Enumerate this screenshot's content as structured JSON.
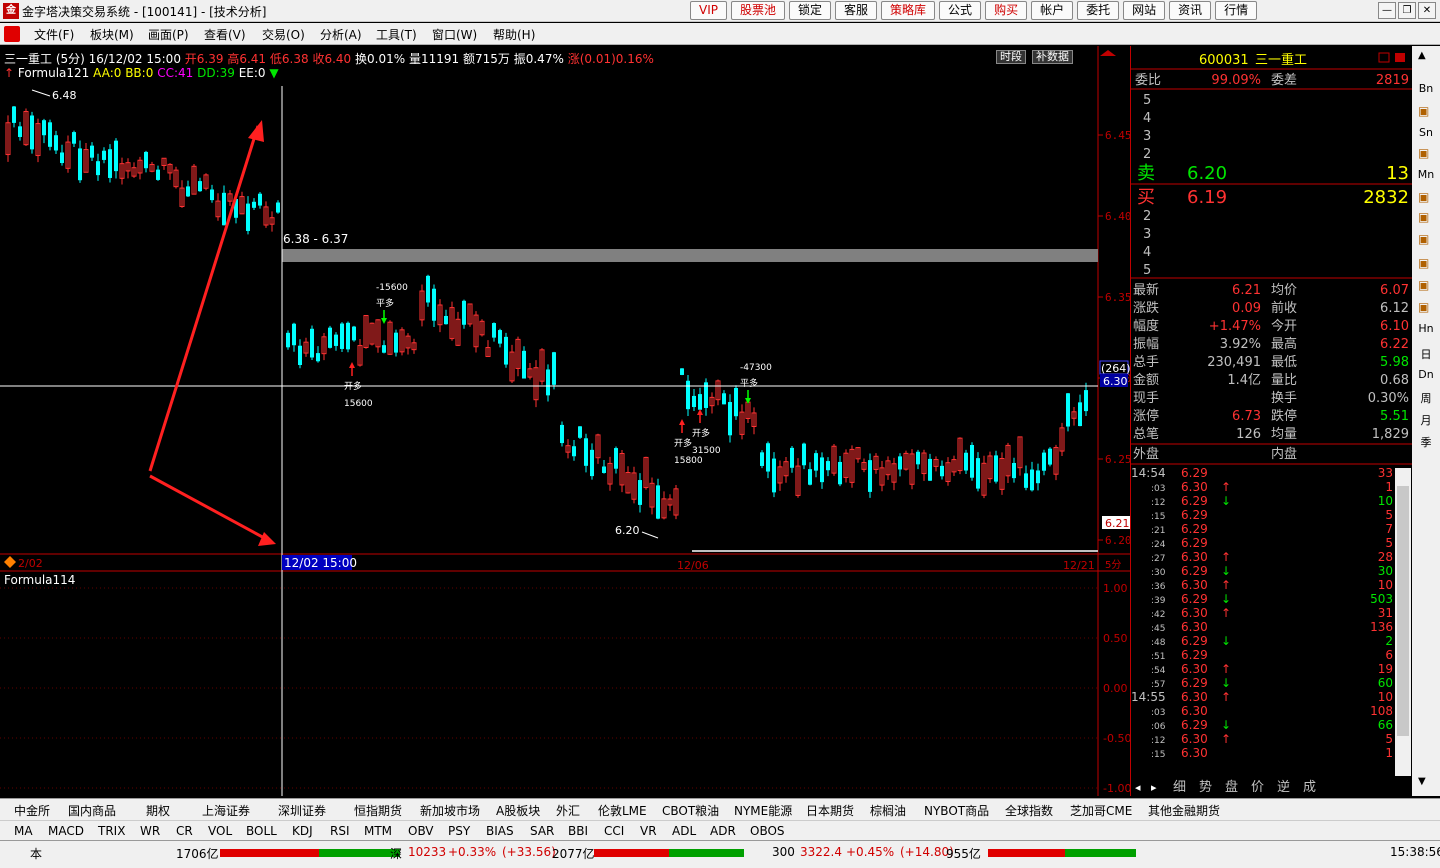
{
  "window": {
    "title": "金字塔决策交易系统 - [100141] - [技术分析]"
  },
  "top_buttons": [
    {
      "label": "VIP",
      "red": true
    },
    {
      "label": "股票池",
      "red": true
    },
    {
      "label": "锁定",
      "red": false
    },
    {
      "label": "客服",
      "red": false
    },
    {
      "label": "策略库",
      "red": true
    },
    {
      "label": "公式",
      "red": false
    },
    {
      "label": "购买",
      "red": true
    },
    {
      "label": "帐户",
      "red": false
    },
    {
      "label": "委托",
      "red": false
    },
    {
      "label": "网站",
      "red": false
    },
    {
      "label": "资讯",
      "red": false
    },
    {
      "label": "行情",
      "red": false
    }
  ],
  "menu": [
    "文件(F)",
    "板块(M)",
    "画面(P)",
    "查看(V)",
    "交易(O)",
    "分析(A)",
    "工具(T)",
    "窗口(W)",
    "帮助(H)"
  ],
  "header": {
    "name_period": "三一重工 (5分)",
    "datetime": "16/12/02 15:00",
    "open": "开6.39",
    "high": "高6.41",
    "low": "低6.38",
    "close": "收6.40",
    "turnover": "换0.01%",
    "vol": "量11191",
    "amount": "额715万",
    "amp": "振0.47%",
    "chg": "涨(0.01)0.16%"
  },
  "formula_line": {
    "name": "Formula121",
    "aa": "AA:0",
    "bb": "BB:0",
    "cc": "CC:41",
    "dd": "DD:39",
    "ee": "EE:0"
  },
  "chart_buttons": {
    "period": "时段",
    "fill": "补数据"
  },
  "price_axis": [
    "6.45",
    "6.40",
    "6.35",
    "6.30",
    "6.25",
    "6.20"
  ],
  "price_tags": {
    "current": "6.30",
    "cursor_vol": "(264)",
    "last": "6.21"
  },
  "labels": {
    "high": "6.48",
    "range": "6.38 - 6.37",
    "low": "6.20",
    "open_long": "开多",
    "close_long": "平多",
    "v1": "15600",
    "v2": "-15600",
    "v3": "31500",
    "v4": "15800",
    "v5": "-47300"
  },
  "date_axis": {
    "d0": "2/02",
    "cursor": "12/02 15:00",
    "d1": "12/06",
    "d2": "12/21",
    "period": "5分"
  },
  "sub_chart": {
    "name": "Formula114",
    "axis": [
      "1.00",
      "0.50",
      "0.00",
      "-0.50",
      "-1.00"
    ]
  },
  "quote": {
    "code": "600031",
    "name": "三一重工",
    "wb_label": "委比",
    "wb": "99.09%",
    "wc_label": "委差",
    "wc": "2819",
    "sell_levels": [
      "5",
      "4",
      "3",
      "2"
    ],
    "sell_label": "卖",
    "sell_price": "6.20",
    "sell_vol": "13",
    "buy_label": "买",
    "buy_price": "6.19",
    "buy_vol": "2832",
    "buy_levels": [
      "2",
      "3",
      "4",
      "5"
    ],
    "rows": [
      [
        "最新",
        "6.21",
        "均价",
        "6.07"
      ],
      [
        "涨跌",
        "0.09",
        "前收",
        "6.12"
      ],
      [
        "幅度",
        "+1.47%",
        "今开",
        "6.10"
      ],
      [
        "振幅",
        "3.92%",
        "最高",
        "6.22"
      ],
      [
        "总手",
        "230,491",
        "最低",
        "5.98"
      ],
      [
        "金额",
        "1.4亿",
        "量比",
        "0.68"
      ],
      [
        "现手",
        "",
        "换手",
        "0.30%"
      ],
      [
        "涨停",
        "6.73",
        "跌停",
        "5.51"
      ],
      [
        "总笔",
        "126",
        "均量",
        "1,829"
      ]
    ],
    "outer": "外盘",
    "inner": "内盘"
  },
  "ticks": [
    [
      "14:54",
      "6.29",
      "",
      "33"
    ],
    [
      ":03",
      "6.30",
      "↑",
      "1"
    ],
    [
      ":12",
      "6.29",
      "↓",
      "10"
    ],
    [
      ":15",
      "6.29",
      "",
      "5"
    ],
    [
      ":21",
      "6.29",
      "",
      "7"
    ],
    [
      ":24",
      "6.29",
      "",
      "5"
    ],
    [
      ":27",
      "6.30",
      "↑",
      "28"
    ],
    [
      ":30",
      "6.29",
      "↓",
      "30"
    ],
    [
      ":36",
      "6.30",
      "↑",
      "10"
    ],
    [
      ":39",
      "6.29",
      "↓",
      "503"
    ],
    [
      ":42",
      "6.30",
      "↑",
      "31"
    ],
    [
      ":45",
      "6.30",
      "",
      "136"
    ],
    [
      ":48",
      "6.29",
      "↓",
      "2"
    ],
    [
      ":51",
      "6.29",
      "",
      "6"
    ],
    [
      ":54",
      "6.30",
      "↑",
      "19"
    ],
    [
      ":57",
      "6.29",
      "↓",
      "60"
    ],
    [
      "14:55",
      "6.30",
      "↑",
      "10"
    ],
    [
      ":03",
      "6.30",
      "",
      "108"
    ],
    [
      ":06",
      "6.29",
      "↓",
      "66"
    ],
    [
      ":12",
      "6.30",
      "↑",
      "5"
    ],
    [
      ":15",
      "6.30",
      "",
      "1"
    ]
  ],
  "tick_tabs": [
    "细",
    "势",
    "盘",
    "价",
    "逆",
    "成"
  ],
  "right_tools": [
    "Bn",
    "Sn",
    "Mn",
    "Hn",
    "日",
    "Dn",
    "周",
    "月",
    "季"
  ],
  "market_tabs": [
    "中金所",
    "国内商品",
    "期权",
    "上海证券",
    "深圳证券",
    "恒指期货",
    "新加坡市场",
    "A股板块",
    "外汇",
    "伦敦LME",
    "CBOT粮油",
    "NYME能源",
    "日本期货",
    "棕榈油",
    "NYBOT商品",
    "全球指数",
    "芝加哥CME",
    "其他金融期货"
  ],
  "indicators": [
    "MA",
    "MACD",
    "TRIX",
    "WR",
    "CR",
    "VOL",
    "BOLL",
    "KDJ",
    "RSI",
    "MTM",
    "OBV",
    "PSY",
    "BIAS",
    "SAR",
    "BBI",
    "CCI",
    "VR",
    "ADL",
    "ADR",
    "OBOS"
  ],
  "status": {
    "left": "本",
    "amt1": "1706亿",
    "sz_label": "深",
    "sz_val": "10233",
    "sz_pct": "+0.33%",
    "sz_chg": "(+33.56)",
    "amt2": "2077亿",
    "hs_label": "300",
    "hs_val": "3322.4",
    "hs_pct": "+0.45%",
    "hs_chg": "(+14.80)",
    "amt3": "955亿",
    "time": "15:38:56"
  }
}
